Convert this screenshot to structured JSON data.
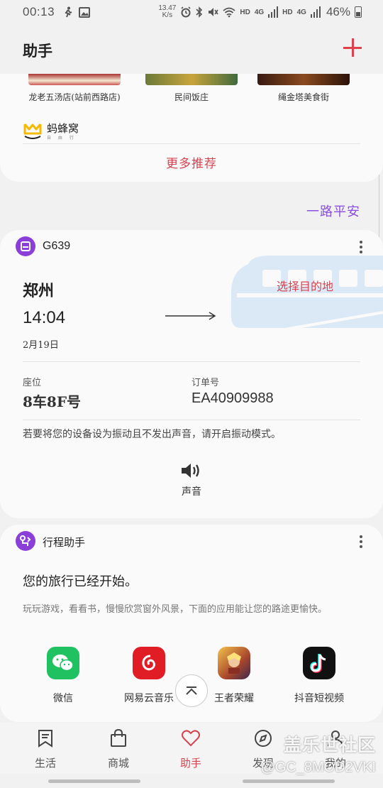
{
  "status_bar": {
    "time": "00:13",
    "net_speed_value": "13.47",
    "net_speed_unit": "K/s",
    "hd1": "HD",
    "net1": "4G",
    "hd2": "HD",
    "net2": "4G",
    "battery": "46%"
  },
  "header": {
    "title": "助手"
  },
  "recommendations": {
    "items": [
      {
        "name": "龙老五汤店(站前西路店)"
      },
      {
        "name": "民间饭庄"
      },
      {
        "name": "绳金塔美食街"
      }
    ],
    "provider": "蚂蜂窝",
    "provider_sub": "自 由 行",
    "more_label": "更多推荐"
  },
  "safe_trip_label": "一路平安",
  "train_card": {
    "train_number": "G639",
    "from_city": "郑州",
    "departure_time": "14:04",
    "date": "2月19日",
    "destination_prompt": "选择目的地",
    "seat_label": "座位",
    "seat_value": "8车8F号",
    "order_label": "订单号",
    "order_value": "EA40909988",
    "vibrate_note": "若要将您的设备设为振动且不发出声音，请开启振动模式。",
    "sound_label": "声音"
  },
  "itinerary_card": {
    "title": "行程助手",
    "heading": "您的旅行已经开始。",
    "description": "玩玩游戏，看看书，慢慢欣赏窗外风景，下面的应用能让您的路途更愉快。",
    "apps": [
      {
        "label": "微信"
      },
      {
        "label": "网易云音乐"
      },
      {
        "label": "王者荣耀"
      },
      {
        "label": "抖音短视频"
      }
    ]
  },
  "bottom_nav": {
    "items": [
      {
        "label": "生活"
      },
      {
        "label": "商城"
      },
      {
        "label": "助手"
      },
      {
        "label": "发现"
      },
      {
        "label": "我的"
      }
    ],
    "active": "助手"
  },
  "watermark": {
    "line1": "盖乐世社区",
    "line2": "@GC_8MOD2VKI"
  },
  "colors": {
    "accent": "#d6434f",
    "purple": "#8a3fd8",
    "safe_trip": "#8a4fe0",
    "background": "#f1f1f1",
    "card": "#fafafa"
  }
}
